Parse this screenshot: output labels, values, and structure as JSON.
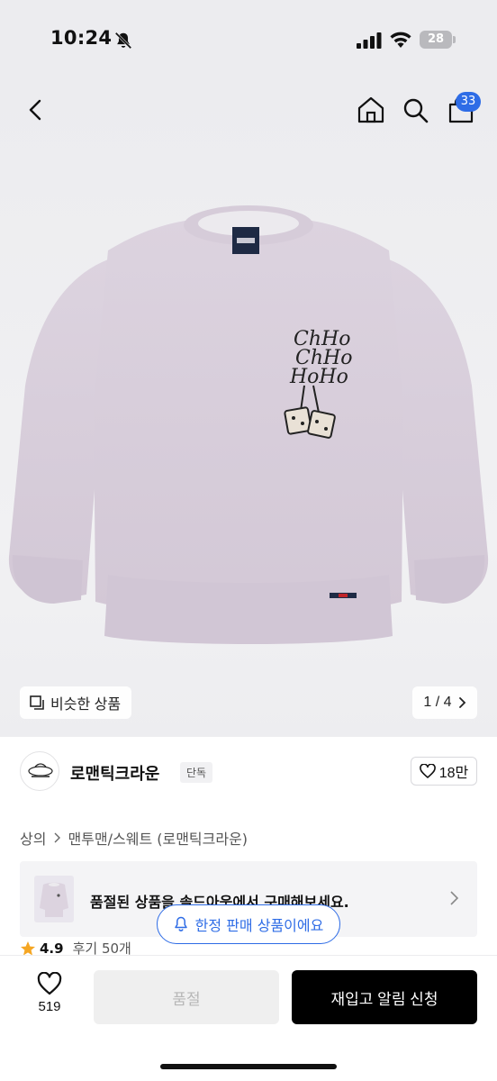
{
  "status_bar": {
    "time": "10:24",
    "battery": "28"
  },
  "header": {
    "cart_count": "33"
  },
  "gallery": {
    "similar_label": "비슷한 상품",
    "page_indicator": "1 / 4"
  },
  "brand": {
    "name": "로맨틱크라운",
    "tag": "단독",
    "likes": "18만"
  },
  "breadcrumb": {
    "items": [
      "상의",
      "맨투맨/스웨트 (로맨틱크라운)"
    ]
  },
  "soldout_banner": {
    "text": "품절된 상품을 솔드아웃에서 구매해보세요."
  },
  "limited_pill": {
    "label": "한정 판매 상품이에요"
  },
  "review": {
    "score": "4.9",
    "count": "후기 50개"
  },
  "bottom_bar": {
    "wish_count": "519",
    "soldout_label": "품절",
    "restock_label": "재입고 알림 신청"
  },
  "colors": {
    "accent": "#2e6ce6",
    "star": "#f5a623",
    "primary_button": "#000000"
  }
}
